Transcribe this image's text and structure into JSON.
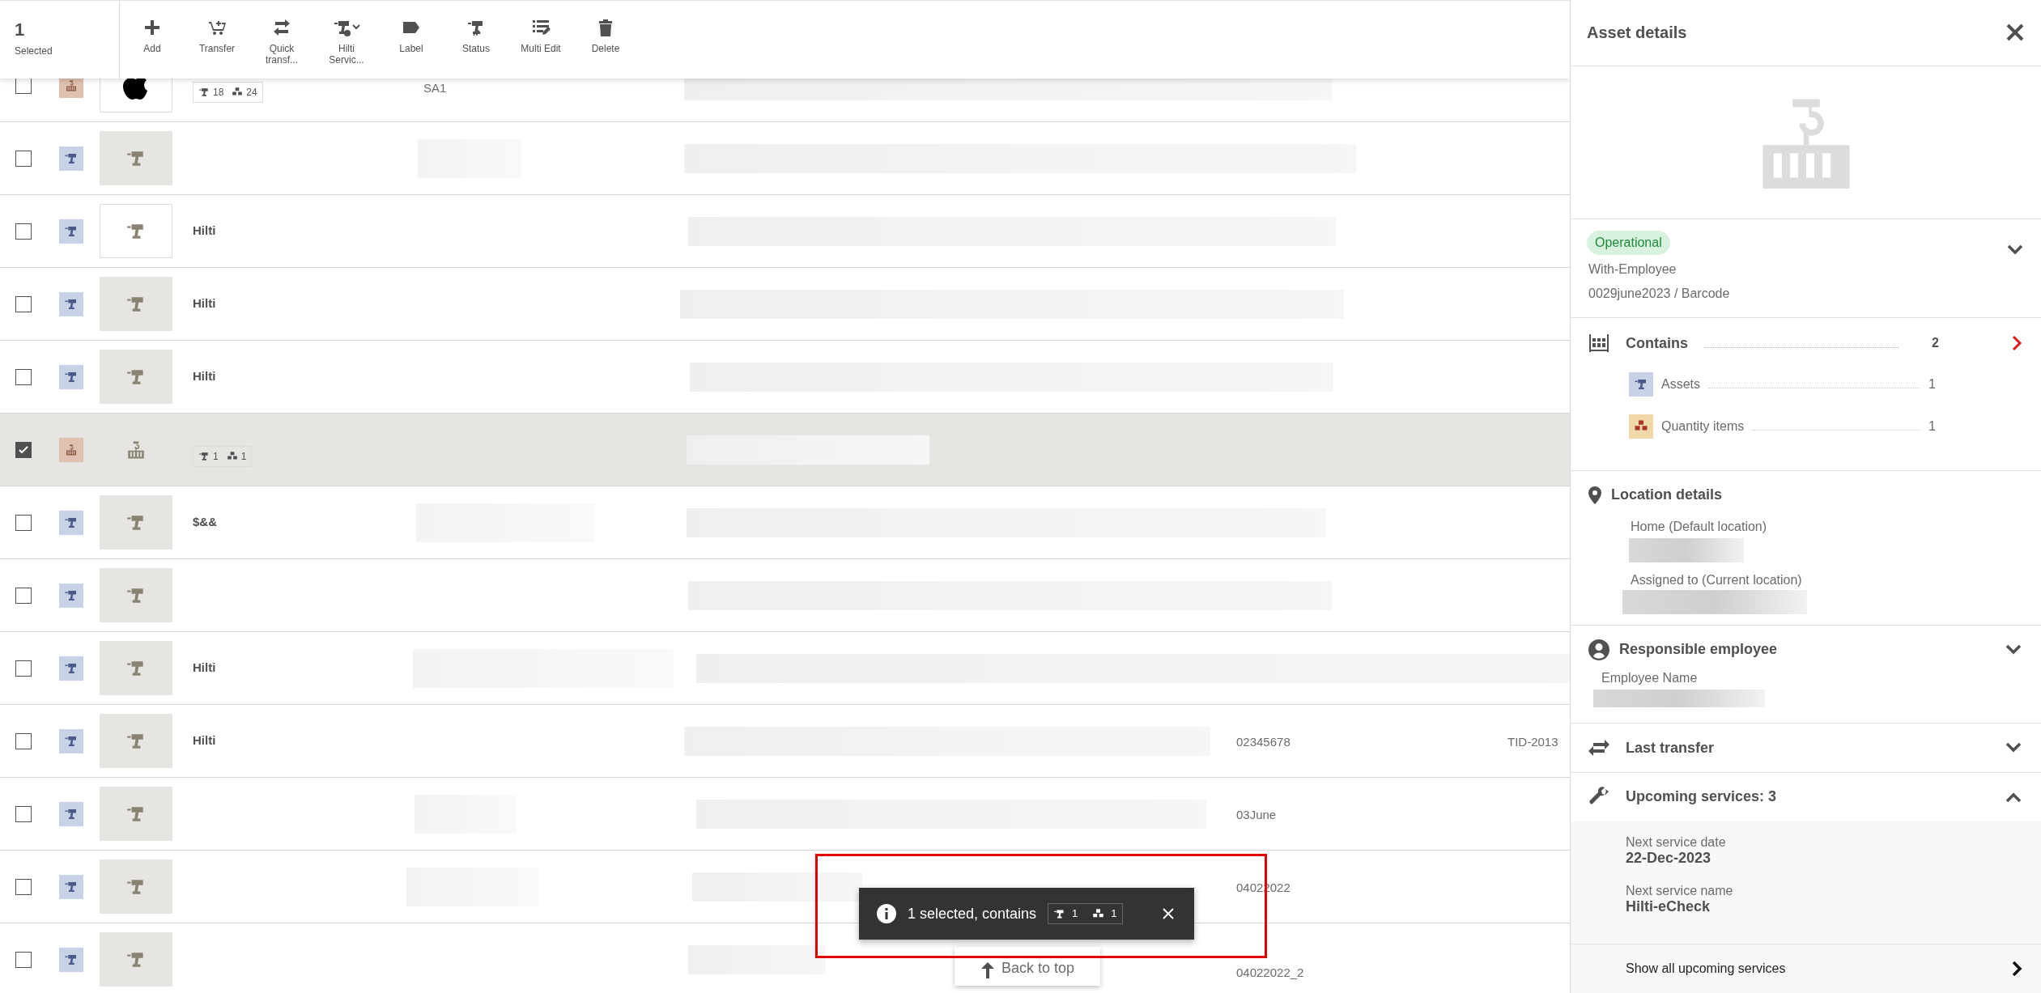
{
  "toolbar": {
    "selected_count": "1",
    "selected_label": "Selected",
    "actions": [
      {
        "label": "Add",
        "kind": "add",
        "dropdown": false
      },
      {
        "label": "Transfer",
        "kind": "transfer",
        "dropdown": false
      },
      {
        "label": "Quick transf...",
        "kind": "quick",
        "dropdown": false
      },
      {
        "label": "Hilti Servic...",
        "kind": "service",
        "dropdown": true
      },
      {
        "label": "Label",
        "kind": "label",
        "dropdown": false
      },
      {
        "label": "Status",
        "kind": "status",
        "dropdown": false
      },
      {
        "label": "Multi Edit",
        "kind": "multi",
        "dropdown": false
      },
      {
        "label": "Delete",
        "kind": "delete",
        "dropdown": false
      }
    ]
  },
  "rows": [
    {
      "kind": "brand",
      "checked": false,
      "counts": {
        "assets": "18",
        "quantity": "24"
      },
      "column_2": "SA1"
    },
    {
      "kind": "asset",
      "checked": false
    },
    {
      "kind": "framed",
      "checked": false,
      "name": "Hilti"
    },
    {
      "kind": "asset",
      "checked": false,
      "name": "Hilti"
    },
    {
      "kind": "asset",
      "checked": false,
      "name": "Hilti"
    },
    {
      "kind": "container",
      "checked": true,
      "counts": {
        "assets": "1",
        "quantity": "1"
      }
    },
    {
      "kind": "asset",
      "checked": false,
      "name": "$&&"
    },
    {
      "kind": "asset",
      "checked": false
    },
    {
      "kind": "asset",
      "checked": false,
      "name": "Hilti"
    },
    {
      "kind": "asset",
      "checked": false,
      "name": "Hilti",
      "column_4": "02345678",
      "column_5": "TID-2013"
    },
    {
      "kind": "asset",
      "checked": false,
      "column_4": "03June"
    },
    {
      "kind": "asset",
      "checked": false,
      "column_4": "04022022"
    },
    {
      "kind": "asset",
      "checked": false,
      "column_4": "04022022_2"
    }
  ],
  "toast": {
    "message": "1 selected, contains",
    "assets": "1",
    "quantity": "1"
  },
  "back_to_top": "Back to top",
  "panel": {
    "title": "Asset details",
    "status": {
      "badge": "Operational",
      "state": "With-Employee",
      "id": "0029june2023 / Barcode",
      "expanded": false
    },
    "contains": {
      "label": "Contains",
      "count": "2",
      "items": [
        {
          "kind": "asset",
          "label": "Assets",
          "count": "1"
        },
        {
          "kind": "quantity",
          "label": "Quantity items",
          "count": "1"
        }
      ]
    },
    "location": {
      "title": "Location details",
      "fields": [
        "Home (Default location)",
        "Assigned to (Current location)"
      ]
    },
    "employee": {
      "title": "Responsible employee",
      "expanded": false,
      "field": "Employee Name"
    },
    "last_transfer": {
      "title": "Last transfer",
      "expanded": false
    },
    "upcoming": {
      "title": "Upcoming services: 3",
      "expanded": true,
      "fields": [
        {
          "label": "Next service date",
          "value": "22-Dec-2023"
        },
        {
          "label": "Next service name",
          "value": "Hilti-eCheck"
        }
      ],
      "link": "Show all upcoming services"
    }
  }
}
